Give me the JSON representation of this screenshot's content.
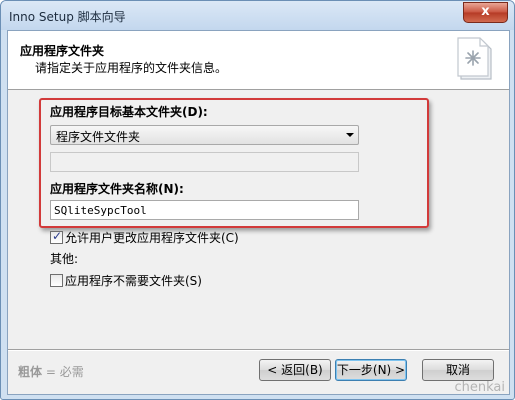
{
  "window": {
    "title": "Inno Setup 脚本向导",
    "close_glyph": "x"
  },
  "header": {
    "title": "应用程序文件夹",
    "subtitle": "请指定关于应用程序的文件夹信息。"
  },
  "form": {
    "dest_base_label": "应用程序目标基本文件夹(D):",
    "dest_base_selected": "程序文件文件夹",
    "folder_name_label": "应用程序文件夹名称(N):",
    "folder_name_value": "SQliteSypcTool",
    "allow_change_label": "允许用户更改应用程序文件夹(C)",
    "allow_change_checked": true,
    "other_label": "其他:",
    "no_folder_label": "应用程序不需要文件夹(S)",
    "no_folder_checked": false
  },
  "footer": {
    "note_bold": "粗体",
    "note_rest": " = 必需",
    "back_label": "< 返回(B)",
    "next_label": "下一步(N) >",
    "cancel_label": "取消"
  },
  "watermark": "chenkai",
  "colors": {
    "highlight": "#d23a3a",
    "accent": "#3c7fb1"
  }
}
